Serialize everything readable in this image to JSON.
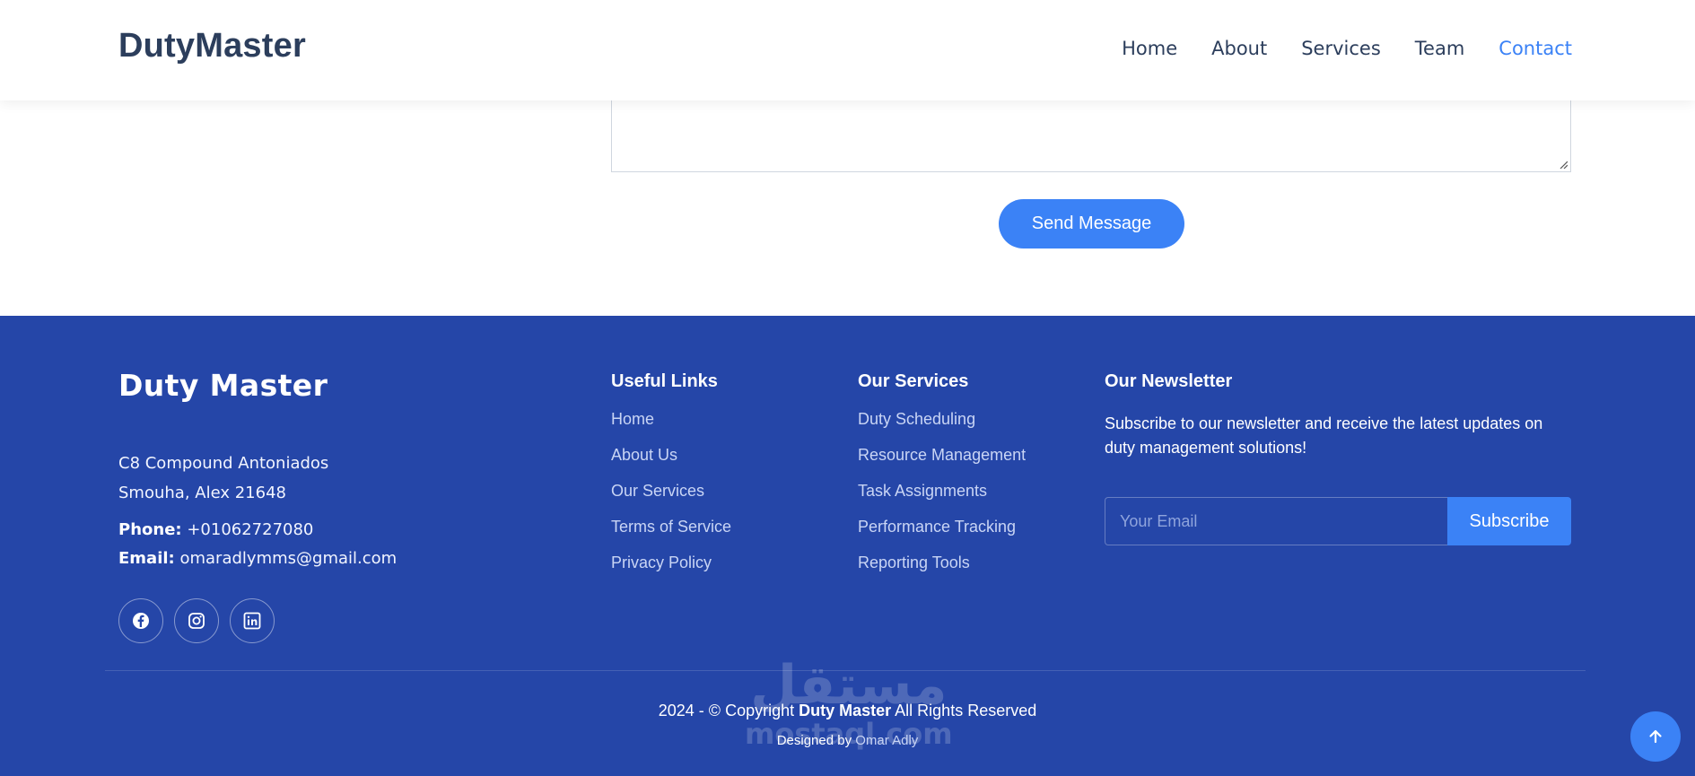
{
  "header": {
    "logo": "DutyMaster",
    "nav": [
      {
        "label": "Home"
      },
      {
        "label": "About"
      },
      {
        "label": "Services"
      },
      {
        "label": "Team"
      },
      {
        "label": "Contact"
      }
    ],
    "active_index": 4
  },
  "form": {
    "send_label": "Send Message"
  },
  "footer": {
    "brand": "Duty Master",
    "address_line1": "C8 Compound Antoniados",
    "address_line2": "Smouha, Alex 21648",
    "phone_label": "Phone:",
    "phone": "+01062727080",
    "email_label": "Email:",
    "email": "omaradlymms@gmail.com",
    "socials": [
      "facebook-icon",
      "instagram-icon",
      "linkedin-icon"
    ],
    "useful_links": {
      "title": "Useful Links",
      "items": [
        "Home",
        "About Us",
        "Our Services",
        "Terms of Service",
        "Privacy Policy"
      ]
    },
    "services": {
      "title": "Our Services",
      "items": [
        "Duty Scheduling",
        "Resource Management",
        "Task Assignments",
        "Performance Tracking",
        "Reporting Tools"
      ]
    },
    "newsletter": {
      "title": "Our Newsletter",
      "text": "Subscribe to our newsletter and receive the latest updates on duty management solutions!",
      "placeholder": "Your Email",
      "button": "Subscribe"
    },
    "copyright_prefix": "2024 - © Copyright",
    "copyright_brand": "Duty Master",
    "copyright_suffix": "All Rights Reserved",
    "designed_prefix": "Designed by",
    "designed_author": "Omar Adly"
  },
  "watermark": {
    "arabic": "مستقل",
    "latin": "mostaql.com"
  },
  "colors": {
    "primary": "#3b82f6",
    "footer_bg": "#2546a8",
    "text_dark": "#2c3e5c"
  }
}
